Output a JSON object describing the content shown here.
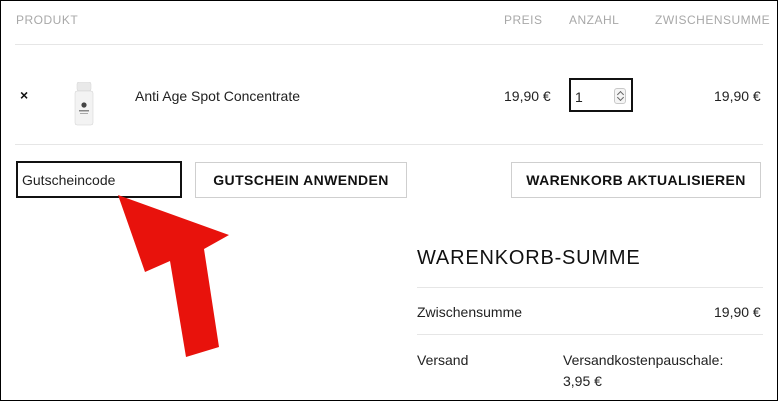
{
  "table": {
    "headers": {
      "product": "PRODUKT",
      "price": "PREIS",
      "quantity": "ANZAHL",
      "subtotal": "ZWISCHENSUMME"
    },
    "rows": [
      {
        "remove": "×",
        "thumbnail_icon": "product-bottle-image",
        "name": "Anti Age Spot Concentrate",
        "price": "19,90 €",
        "quantity": "1",
        "subtotal": "19,90 €"
      }
    ]
  },
  "coupon": {
    "placeholder": "Gutscheincode",
    "apply_label": "GUTSCHEIN ANWENDEN"
  },
  "update_cart_label": "WARENKORB AKTUALISIEREN",
  "annotation": {
    "arrow_color": "#e8120c"
  },
  "totals": {
    "title": "WARENKORB-SUMME",
    "subtotal_label": "Zwischensumme",
    "subtotal_value": "19,90 €",
    "shipping_label": "Versand",
    "shipping_line1": "Versandkostenpauschale:",
    "shipping_line2": "3,95 €"
  }
}
